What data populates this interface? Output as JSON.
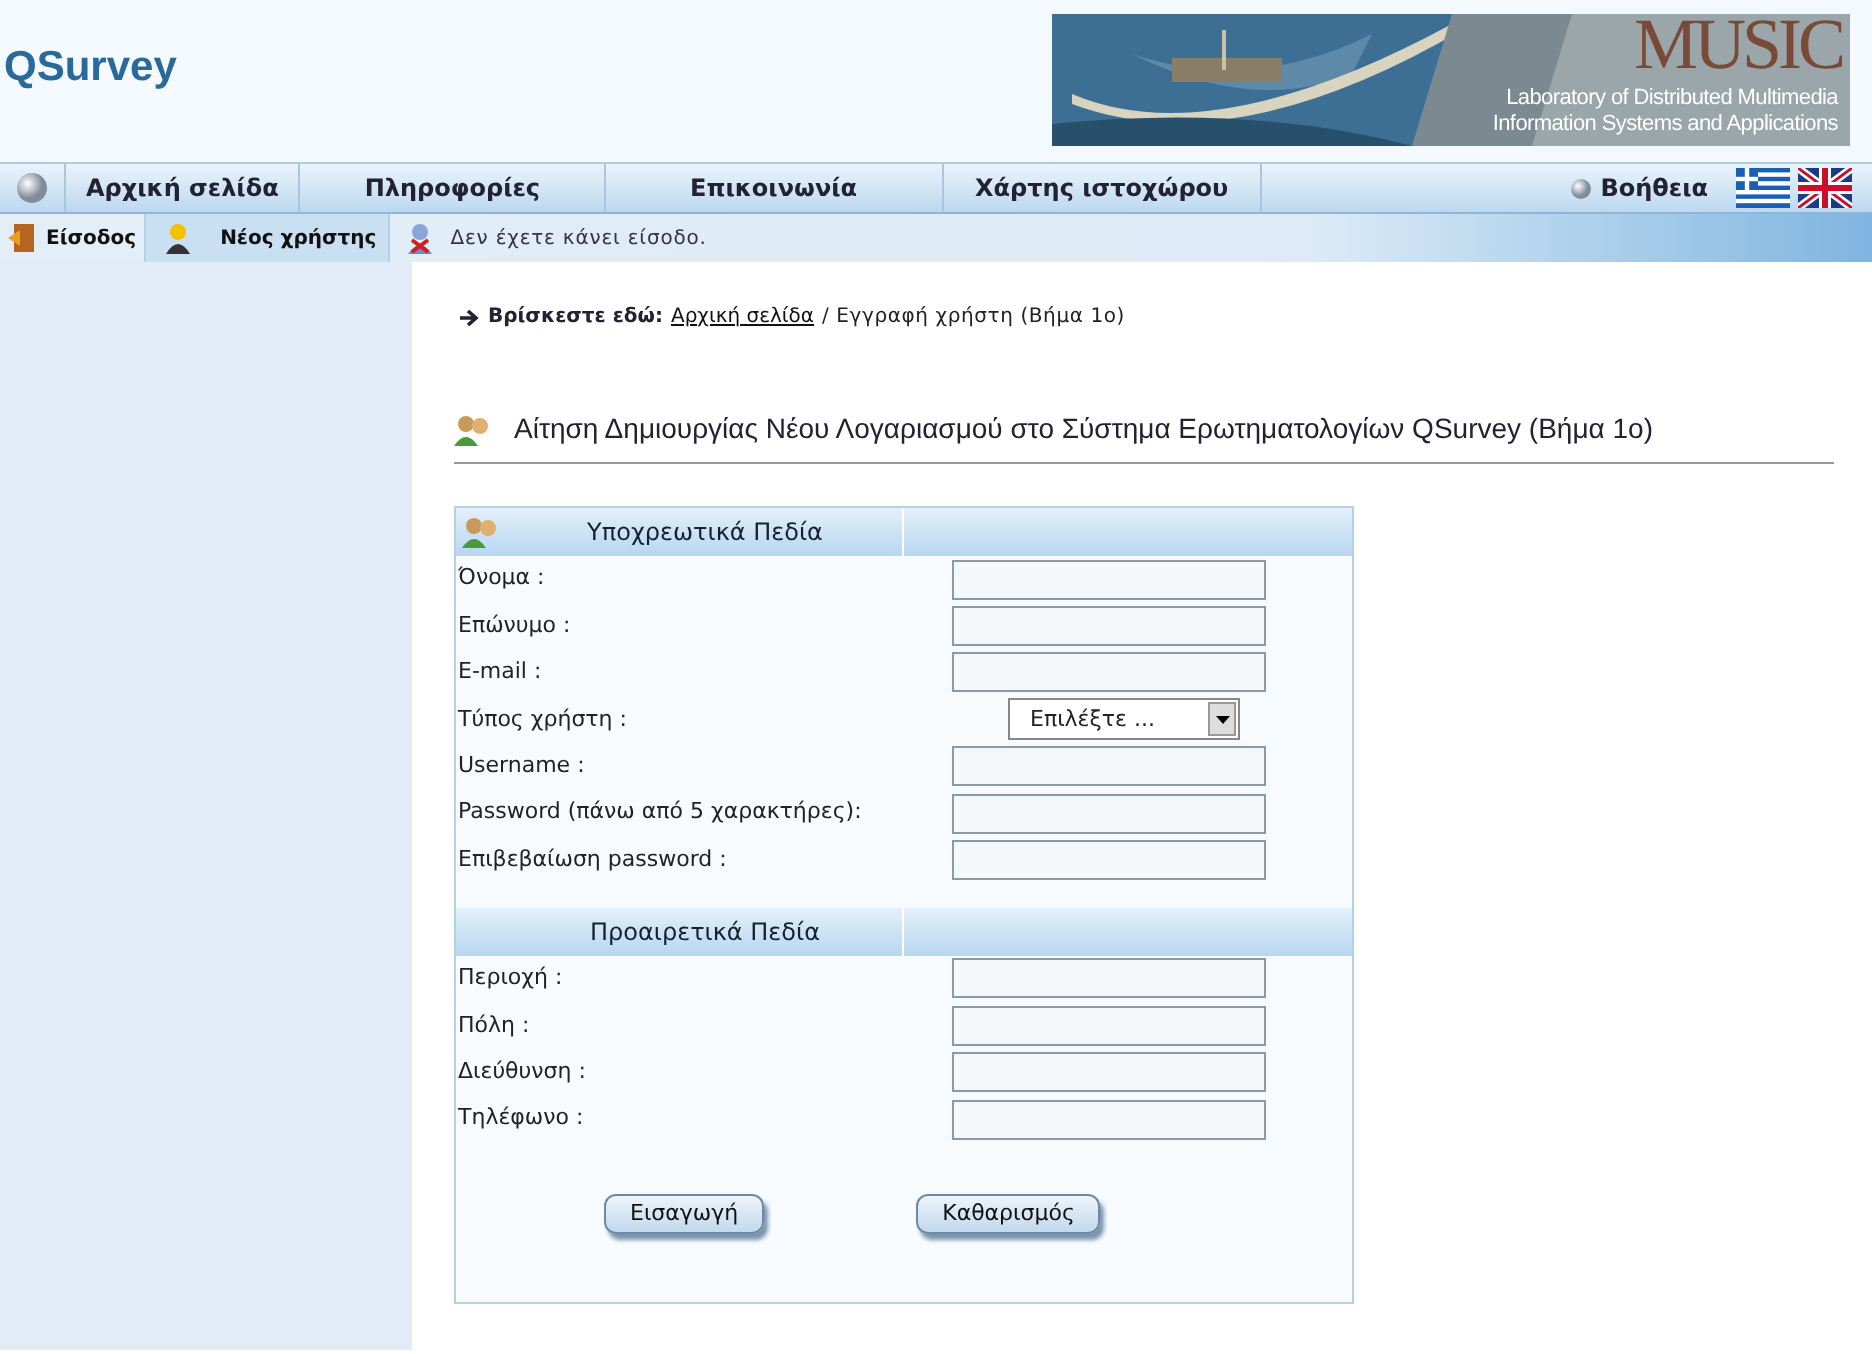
{
  "site_title": "QSurvey",
  "banner": {
    "kind": "picture",
    "big_text": "MUSIC",
    "lines": [
      "Laboratory of Distributed Multimedia",
      "Information Systems and Applications"
    ]
  },
  "main_menu": [
    {
      "label": "Αρχική σελίδα"
    },
    {
      "label": "Πληροφορίες"
    },
    {
      "label": "Επικοινωνία"
    },
    {
      "label": "Χάρτης ιστοχώρου"
    }
  ],
  "help_link": "Βοήθεια",
  "user_bar": {
    "items": [
      {
        "label": "Είσοδος",
        "selected": false
      },
      {
        "label": "Νέος χρήστης",
        "selected": true
      }
    ],
    "status": "Δεν έχετε κάνει είσοδο."
  },
  "breadcrumb": {
    "prefix": "Βρίσκεστε εδώ:",
    "link": "Αρχική σελίδα",
    "current": "/ Εγγραφή χρήστη (Βήμα 1ο)"
  },
  "page_title": "Αίτηση Δημιουργίας Νέου Λογαριασμού στο Σύστημα Ερωτηματολογίων QSurvey (Βήμα 1ο)",
  "sections": [
    {
      "title": "Υποχρεωτικά Πεδία",
      "icon": true,
      "fields": [
        {
          "label": "Όνομα :",
          "kind": "text"
        },
        {
          "label": "Επώνυμο :",
          "kind": "text"
        },
        {
          "label": "E-mail :",
          "kind": "text"
        },
        {
          "label": "Τύπος χρήστη :",
          "kind": "select",
          "value": "Επιλέξτε ..."
        },
        {
          "label": "Username :",
          "kind": "text"
        },
        {
          "label": "Password (πάνω από 5 χαρακτήρες):",
          "kind": "text"
        },
        {
          "label": "Επιβεβαίωση password :",
          "kind": "text"
        }
      ]
    },
    {
      "title": "Προαιρετικά Πεδία",
      "icon": false,
      "fields": [
        {
          "label": "Περιοχή :",
          "kind": "text"
        },
        {
          "label": "Πόλη :",
          "kind": "text"
        },
        {
          "label": "Διεύθυνση :",
          "kind": "text"
        },
        {
          "label": "Τηλέφωνο :",
          "kind": "text"
        }
      ]
    }
  ],
  "buttons": [
    "Εισαγωγή",
    "Καθαρισμός"
  ]
}
